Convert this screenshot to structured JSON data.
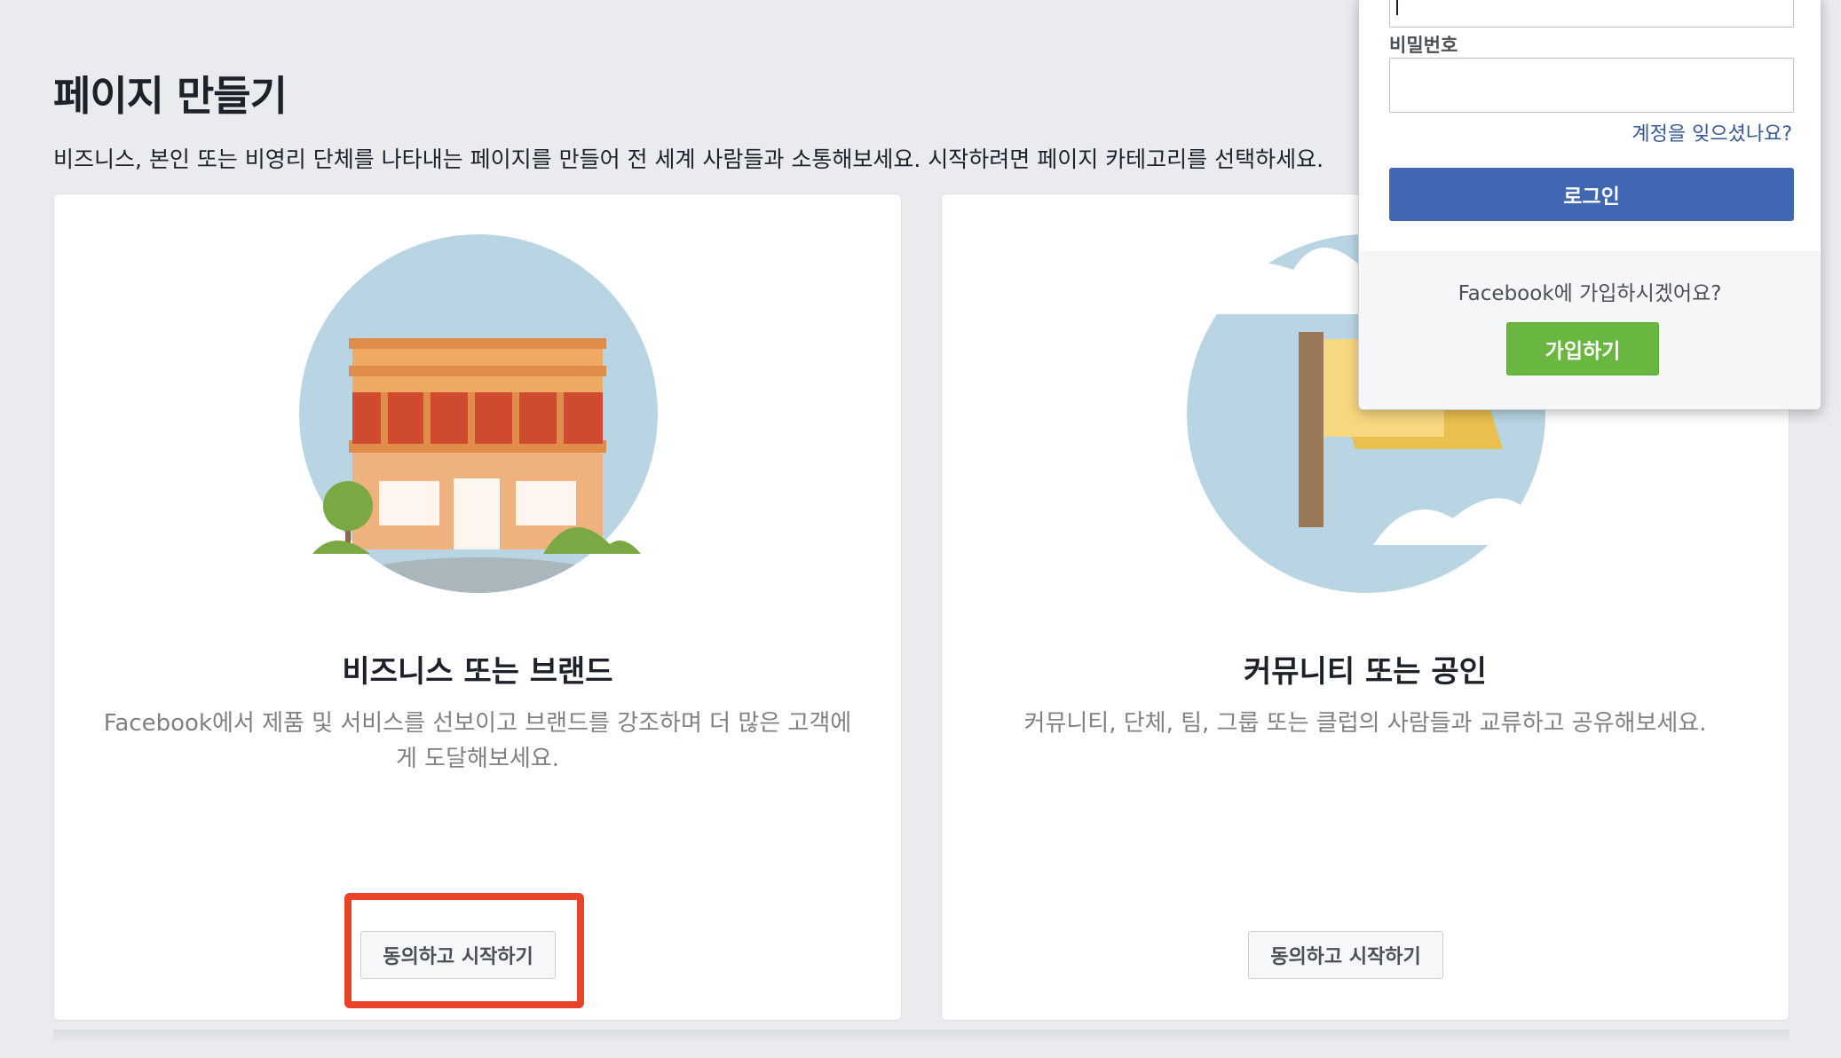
{
  "page": {
    "title": "페이지 만들기",
    "subtitle": "비즈니스, 본인 또는 비영리 단체를 나타내는 페이지를 만들어 전 세계 사람들과 소통해보세요. 시작하려면 페이지 카테고리를 선택하세요."
  },
  "cards": [
    {
      "title": "비즈니스 또는 브랜드",
      "description": "Facebook에서 제품 및 서비스를 선보이고 브랜드를 강조하며 더 많은 고객에게 도달해보세요.",
      "button_label": "동의하고 시작하기",
      "icon": "storefront-icon"
    },
    {
      "title": "커뮤니티 또는 공인",
      "description": "커뮤니티, 단체, 팀, 그룹 또는 클럽의 사람들과 교류하고 공유해보세요.",
      "button_label": "동의하고 시작하기",
      "icon": "flag-icon"
    }
  ],
  "login_popup": {
    "email_value": "",
    "password_label": "비밀번호",
    "password_value": "",
    "forgot_link": "계정을 잊으셨나요?",
    "login_button": "로그인",
    "signup_prompt": "Facebook에 가입하시겠어요?",
    "signup_button": "가입하기"
  },
  "colors": {
    "background": "#e9ebee",
    "primary_blue": "#4267b2",
    "link_blue": "#365899",
    "signup_green": "#69b740",
    "highlight_red": "#e8442a"
  }
}
